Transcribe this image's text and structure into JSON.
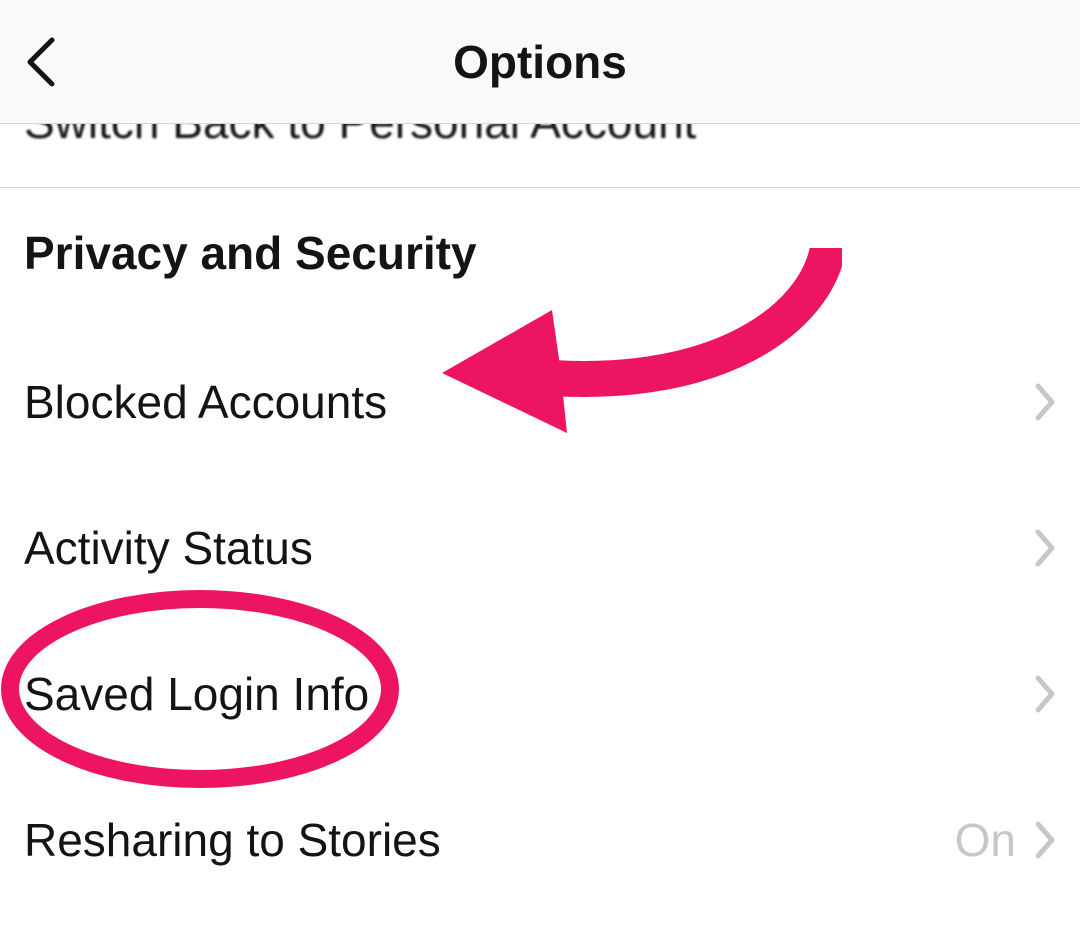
{
  "nav": {
    "title": "Options"
  },
  "scrolled_item_label": "Switch Back to Personal Account",
  "section": {
    "header": "Privacy and Security",
    "items": [
      {
        "label": "Blocked Accounts",
        "value": ""
      },
      {
        "label": "Activity Status",
        "value": ""
      },
      {
        "label": "Saved Login Info",
        "value": ""
      },
      {
        "label": "Resharing to Stories",
        "value": "On"
      }
    ]
  },
  "annotation": {
    "color": "#ed1562"
  }
}
